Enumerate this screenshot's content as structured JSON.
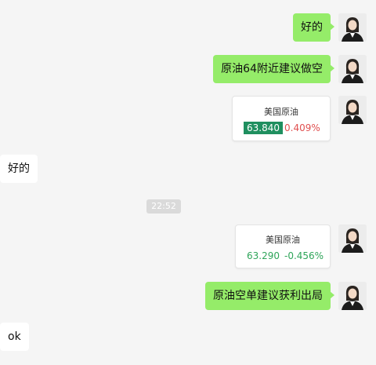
{
  "messages": {
    "m1": {
      "text": "好的"
    },
    "m2": {
      "text": "原油64附近建议做空"
    },
    "m3": {
      "name": "美国原油",
      "price": "63.840",
      "change": "0.409%",
      "price_bg": "#1f8f5f",
      "change_color": "#e05050"
    },
    "m4": {
      "text": "好的"
    },
    "m5": {
      "name": "美国原油",
      "price": "63.290",
      "change": "-0.456%",
      "price_color": "#2fa55a",
      "change_color": "#2fa55a"
    },
    "m6": {
      "text": "原油空单建议获利出局"
    },
    "m7": {
      "text": "ok"
    }
  },
  "timestamp": "22:52",
  "avatar_icon": "woman-avatar-icon"
}
